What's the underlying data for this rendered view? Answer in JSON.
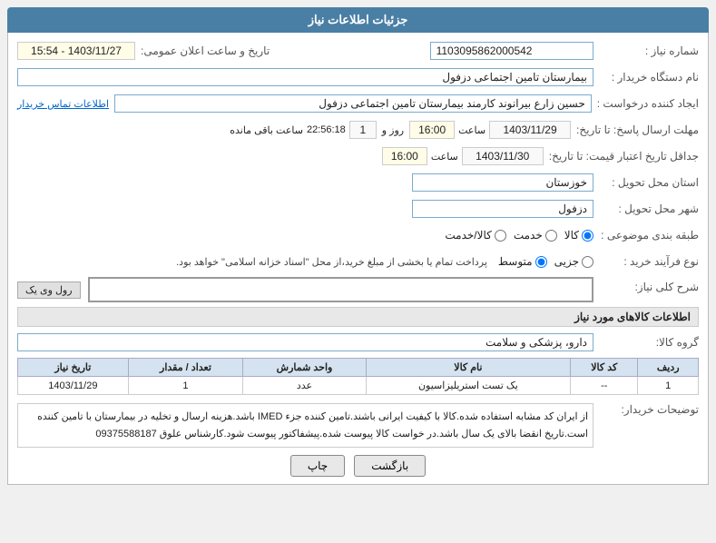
{
  "header": {
    "title": "جزئیات اطلاعات نیاز"
  },
  "fields": {
    "shmare_niaz_label": "شماره نیاز :",
    "shmare_niaz_value": "1103095862000542",
    "dastgah_khardar_label": "نام دستگاه خریدار :",
    "dastgah_khardar_value": "بیمارستان تامین اجتماعی دزفول",
    "ijad_konande_label": "ایجاد کننده درخواست :",
    "ijad_konande_value": "حسین زارع بیرانوند کارمند بیمارستان تامین اجتماعی دزفول",
    "ijad_konande_link": "اطلاعات تماس خریدار",
    "mohlet_ersal_label": "مهلت ارسال پاسخ: تا تاریخ:",
    "mohlet_date": "1403/11/29",
    "mohlet_saat_label": "ساعت",
    "mohlet_saat_value": "16:00",
    "mohlet_roz_label": "روز و",
    "mohlet_roz_value": "1",
    "mohlet_saat2_label": "ساعت باقی مانده",
    "mohlet_saat2_value": "22:56:18",
    "jadval_label": "جداقل تاریخ اعتبار قیمت: تا تاریخ:",
    "jadval_date": "1403/11/30",
    "jadval_saat_label": "ساعت",
    "jadval_saat_value": "16:00",
    "ostan_label": "استان محل تحویل :",
    "ostan_value": "خوزستان",
    "shahr_label": "شهر محل تحویل :",
    "shahr_value": "دزفول",
    "tabaghe_label": "طبقه بندی موضوعی :",
    "tabaghe_options": [
      "کالا",
      "خدمت",
      "کالا/خدمت"
    ],
    "tabaghe_selected": "کالا",
    "nov_farayand_label": "نوع فرآیند خرید :",
    "nov_farayand_options": [
      "جزیی",
      "متوسط"
    ],
    "nov_farayand_selected": "متوسط",
    "nov_farayand_note": "پرداخت تمام یا بخشی از مبلغ خرید،از محل \"اسناد خزانه اسلامی\" خواهد بود.",
    "tarikh_ersal_label": "تاریخ و ساعت اعلان عمومی:",
    "tarikh_ersal_value": "1403/11/27 - 15:54",
    "shrh_niaz_label": "شرح کلی نیاز:",
    "shrh_niaz_placeholder": "رول وی یک",
    "akalaha_title": "اطلاعات کالاهای مورد نیاز",
    "grohe_kala_label": "گروه کالا:",
    "grohe_kala_value": "دارو، پزشکی و سلامت",
    "table": {
      "headers": [
        "ردیف",
        "کد کالا",
        "نام کالا",
        "واحد شمارش",
        "تعداد / مقدار",
        "تاریخ نیاز"
      ],
      "rows": [
        {
          "radif": "1",
          "kod_kala": "--",
          "nam_kala": "یک تست استریلیزاسیون",
          "vahed": "عدد",
          "tedad": "1",
          "tarikh": "1403/11/29"
        }
      ]
    },
    "buyer_comments_label": "توضیحات خریدار:",
    "buyer_comments_value": "از ایران کد مشابه استفاده شده.کالا با کیفیت ایرانی باشند.تامین کننده جزء IMED باشد.هزینه ارسال و تخلیه در بیمارستان با تامین کننده است.تاریخ انقضا بالای یک سال باشد.در خواست کالا پیوست شده.پیشفاکتور پیوست شود.کارشناس علوق 09375588187",
    "buttons": {
      "chap": "چاپ",
      "bazgasht": "بازگشت"
    }
  }
}
